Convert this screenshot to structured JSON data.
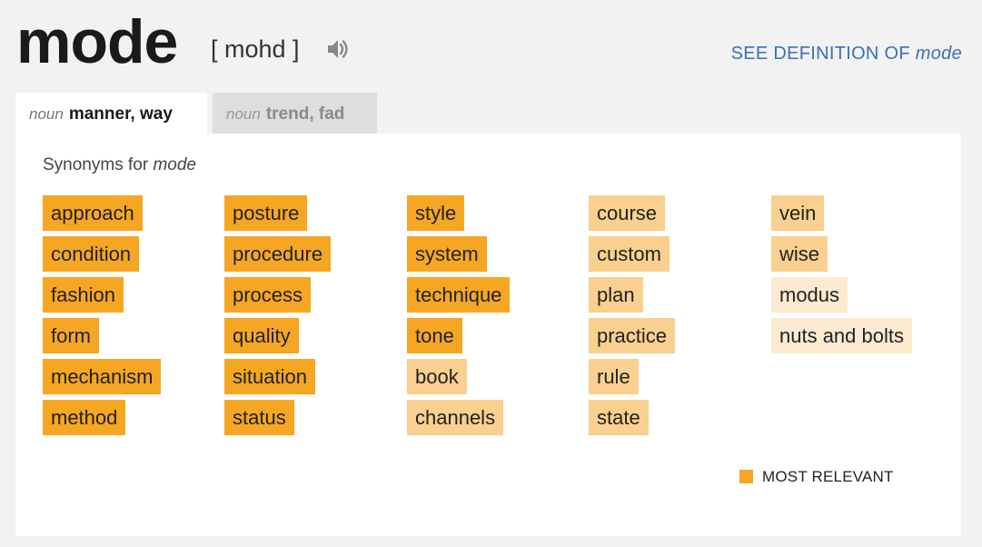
{
  "entry": {
    "word": "mode",
    "pronunciation": "[ mohd ]",
    "see_definition_prefix": "SEE DEFINITION OF",
    "see_definition_word": "mode"
  },
  "tabs": [
    {
      "pos": "noun",
      "label": "manner, way",
      "active": true
    },
    {
      "pos": "noun",
      "label": "trend, fad",
      "active": false
    }
  ],
  "synonyms": {
    "heading_prefix": "Synonyms for",
    "heading_word": "mode",
    "columns": [
      [
        {
          "word": "approach",
          "relevance": 3
        },
        {
          "word": "condition",
          "relevance": 3
        },
        {
          "word": "fashion",
          "relevance": 3
        },
        {
          "word": "form",
          "relevance": 3
        },
        {
          "word": "mechanism",
          "relevance": 3
        },
        {
          "word": "method",
          "relevance": 3
        }
      ],
      [
        {
          "word": "posture",
          "relevance": 3
        },
        {
          "word": "procedure",
          "relevance": 3
        },
        {
          "word": "process",
          "relevance": 3
        },
        {
          "word": "quality",
          "relevance": 3
        },
        {
          "word": "situation",
          "relevance": 3
        },
        {
          "word": "status",
          "relevance": 3
        }
      ],
      [
        {
          "word": "style",
          "relevance": 3
        },
        {
          "word": "system",
          "relevance": 3
        },
        {
          "word": "technique",
          "relevance": 3
        },
        {
          "word": "tone",
          "relevance": 3
        },
        {
          "word": "book",
          "relevance": 2
        },
        {
          "word": "channels",
          "relevance": 2
        }
      ],
      [
        {
          "word": "course",
          "relevance": 2
        },
        {
          "word": "custom",
          "relevance": 2
        },
        {
          "word": "plan",
          "relevance": 2
        },
        {
          "word": "practice",
          "relevance": 2
        },
        {
          "word": "rule",
          "relevance": 2
        },
        {
          "word": "state",
          "relevance": 2
        }
      ],
      [
        {
          "word": "vein",
          "relevance": 2
        },
        {
          "word": "wise",
          "relevance": 2
        },
        {
          "word": "modus",
          "relevance": 1
        },
        {
          "word": "nuts and bolts",
          "relevance": 1
        }
      ]
    ]
  },
  "legend": {
    "label": "MOST RELEVANT"
  },
  "icons": {
    "speaker": "speaker-icon"
  },
  "colors": {
    "relevance_3": "#f5a623",
    "relevance_2": "#f9d08f",
    "relevance_1": "#fcebd1",
    "link": "#3b6fb6"
  }
}
